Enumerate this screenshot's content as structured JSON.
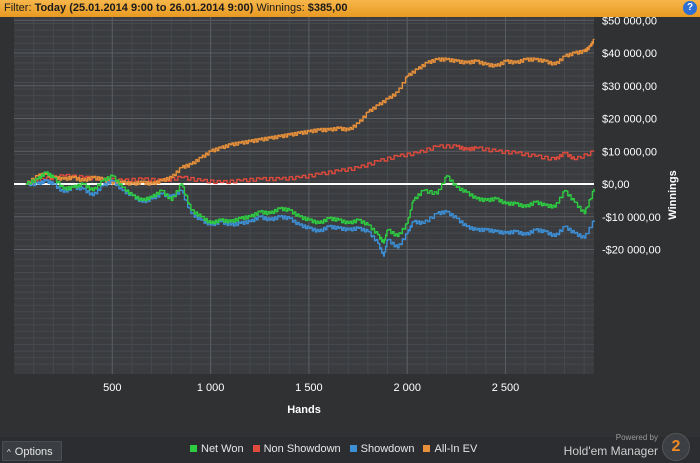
{
  "filter": {
    "label": "Filter:",
    "value": "Today (25.01.2014 9:00 to 26.01.2014 9:00)",
    "winnings_label": "Winnings:",
    "winnings_value": "$385,00"
  },
  "help": {
    "glyph": "?"
  },
  "options": {
    "label": "Options",
    "chevron": "^"
  },
  "brand": {
    "powered": "Powered by",
    "name": "Hold'em Manager",
    "logo_glyph": "2"
  },
  "chart_data": {
    "type": "line",
    "xlabel": "Hands",
    "ylabel": "Winnings",
    "xlim": [
      0,
      2950
    ],
    "ylim": [
      -58000,
      51000
    ],
    "x_ticks": [
      500,
      1000,
      1500,
      2000,
      2500
    ],
    "x_tick_labels": [
      "500",
      "1 000",
      "1 500",
      "2 000",
      "2 500"
    ],
    "y_ticks": [
      50000,
      40000,
      30000,
      20000,
      10000,
      0,
      -10000,
      -20000
    ],
    "y_tick_labels": [
      "$50 000,00",
      "$40 000,00",
      "$30 000,00",
      "$20 000,00",
      "$10 000,00",
      "$0,00",
      "-$10 000,00",
      "-$20 000,00"
    ],
    "grid": true,
    "legend": "bottom-center",
    "zero_line_color": "#ffffff",
    "series": [
      {
        "name": "Net Won",
        "color": "#2ecc40",
        "x": [
          60,
          120,
          160,
          200,
          250,
          300,
          350,
          400,
          450,
          500,
          550,
          600,
          650,
          700,
          750,
          800,
          850,
          900,
          950,
          1000,
          1050,
          1100,
          1150,
          1200,
          1250,
          1300,
          1350,
          1400,
          1450,
          1500,
          1550,
          1600,
          1650,
          1700,
          1750,
          1800,
          1850,
          1880,
          1900,
          1950,
          2000,
          2030,
          2080,
          2150,
          2200,
          2250,
          2300,
          2350,
          2400,
          2450,
          2500,
          2550,
          2600,
          2650,
          2700,
          2750,
          2800,
          2850,
          2900,
          2950
        ],
        "y": [
          0,
          1500,
          3500,
          2000,
          -1500,
          -1000,
          0,
          -2000,
          1000,
          2500,
          -1000,
          -3500,
          -5000,
          -4000,
          -2000,
          -5000,
          0,
          -8000,
          -10000,
          -12000,
          -11000,
          -11500,
          -10500,
          -10000,
          -8500,
          -9000,
          -7500,
          -8000,
          -10000,
          -11000,
          -12000,
          -10500,
          -11000,
          -12000,
          -11000,
          -12500,
          -15500,
          -18000,
          -14000,
          -16000,
          -12000,
          -5000,
          -2000,
          -3000,
          2500,
          -1000,
          -2500,
          -4500,
          -5000,
          -4500,
          -6000,
          -6000,
          -7000,
          -5500,
          -6500,
          -7000,
          -2000,
          -5500,
          -9000,
          -1500
        ]
      },
      {
        "name": "Non Showdown",
        "color": "#e04a3c",
        "x": [
          60,
          150,
          250,
          350,
          450,
          550,
          650,
          750,
          850,
          950,
          1050,
          1150,
          1250,
          1350,
          1450,
          1550,
          1650,
          1750,
          1850,
          1950,
          2050,
          2150,
          2250,
          2300,
          2350,
          2450,
          2550,
          2650,
          2750,
          2800,
          2850,
          2950
        ],
        "y": [
          0,
          1500,
          2500,
          2000,
          1500,
          1000,
          1500,
          1000,
          2000,
          1000,
          500,
          1000,
          1500,
          1500,
          2000,
          3000,
          4000,
          5000,
          7000,
          8500,
          9500,
          11500,
          11500,
          10500,
          11000,
          10000,
          9500,
          8500,
          7500,
          9500,
          7500,
          10000
        ]
      },
      {
        "name": "Showdown",
        "color": "#3d8fd6",
        "x": [
          60,
          120,
          160,
          200,
          250,
          300,
          350,
          400,
          450,
          500,
          550,
          600,
          650,
          700,
          750,
          800,
          850,
          900,
          950,
          1000,
          1050,
          1100,
          1150,
          1200,
          1250,
          1300,
          1350,
          1400,
          1450,
          1500,
          1550,
          1600,
          1650,
          1700,
          1750,
          1800,
          1850,
          1880,
          1900,
          1950,
          2000,
          2030,
          2080,
          2150,
          2200,
          2250,
          2300,
          2350,
          2400,
          2450,
          2500,
          2550,
          2600,
          2650,
          2700,
          2750,
          2800,
          2850,
          2900,
          2950
        ],
        "y": [
          0,
          0,
          1000,
          0,
          -2500,
          -1000,
          -1500,
          -3500,
          -500,
          1000,
          -2000,
          -3500,
          -5500,
          -4500,
          -3000,
          -4000,
          -2000,
          -9000,
          -11000,
          -12500,
          -11500,
          -12500,
          -12000,
          -11500,
          -10000,
          -11000,
          -10000,
          -10500,
          -12500,
          -13500,
          -14500,
          -13000,
          -13500,
          -14000,
          -13500,
          -14500,
          -18000,
          -22000,
          -17000,
          -19500,
          -15000,
          -11500,
          -12000,
          -9000,
          -8500,
          -10500,
          -13000,
          -14000,
          -14000,
          -14500,
          -15000,
          -14500,
          -15500,
          -14000,
          -14500,
          -16000,
          -13000,
          -15000,
          -16500,
          -11000
        ]
      },
      {
        "name": "All-In EV",
        "color": "#e8913a",
        "x": [
          60,
          120,
          160,
          200,
          250,
          300,
          350,
          400,
          450,
          500,
          550,
          600,
          650,
          700,
          750,
          800,
          850,
          900,
          950,
          1000,
          1050,
          1100,
          1150,
          1200,
          1250,
          1300,
          1350,
          1400,
          1450,
          1500,
          1550,
          1600,
          1650,
          1700,
          1750,
          1800,
          1850,
          1900,
          1950,
          2000,
          2050,
          2100,
          2150,
          2200,
          2250,
          2300,
          2350,
          2400,
          2450,
          2500,
          2550,
          2600,
          2650,
          2700,
          2750,
          2800,
          2850,
          2900,
          2930,
          2950
        ],
        "y": [
          0,
          2500,
          3000,
          2000,
          1500,
          2000,
          1000,
          2000,
          1500,
          0,
          500,
          0,
          500,
          0,
          1000,
          2000,
          5000,
          6000,
          8000,
          10000,
          11000,
          12000,
          12500,
          13000,
          13500,
          14000,
          14500,
          15000,
          15500,
          16000,
          16500,
          16500,
          17000,
          16500,
          18500,
          22000,
          24000,
          26000,
          28000,
          33000,
          35000,
          37000,
          38000,
          38000,
          37500,
          37000,
          37500,
          36500,
          36000,
          37500,
          37000,
          38000,
          38000,
          37500,
          36500,
          39000,
          40000,
          40500,
          42000,
          44000
        ]
      }
    ]
  }
}
